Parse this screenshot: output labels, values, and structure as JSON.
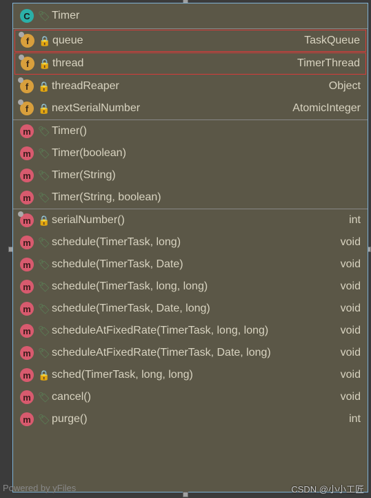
{
  "header": {
    "class_name": "Timer"
  },
  "fields": [
    {
      "name": "queue",
      "type": "TaskQueue",
      "access": "private",
      "pinned": true,
      "highlight": true
    },
    {
      "name": "thread",
      "type": "TimerThread",
      "access": "private",
      "pinned": true,
      "highlight": true
    },
    {
      "name": "threadReaper",
      "type": "Object",
      "access": "private",
      "pinned": true,
      "highlight": false
    },
    {
      "name": "nextSerialNumber",
      "type": "AtomicInteger",
      "access": "private",
      "pinned": true,
      "highlight": false
    }
  ],
  "constructors": [
    {
      "signature": "Timer()"
    },
    {
      "signature": "Timer(boolean)"
    },
    {
      "signature": "Timer(String)"
    },
    {
      "signature": "Timer(String, boolean)"
    }
  ],
  "methods": [
    {
      "signature": "serialNumber()",
      "return": "int",
      "access": "private",
      "pinned": true
    },
    {
      "signature": "schedule(TimerTask, long)",
      "return": "void",
      "access": "public",
      "pinned": false
    },
    {
      "signature": "schedule(TimerTask, Date)",
      "return": "void",
      "access": "public",
      "pinned": false
    },
    {
      "signature": "schedule(TimerTask, long, long)",
      "return": "void",
      "access": "public",
      "pinned": false
    },
    {
      "signature": "schedule(TimerTask, Date, long)",
      "return": "void",
      "access": "public",
      "pinned": false
    },
    {
      "signature": "scheduleAtFixedRate(TimerTask, long, long)",
      "return": "void",
      "access": "public",
      "pinned": false
    },
    {
      "signature": "scheduleAtFixedRate(TimerTask, Date, long)",
      "return": "void",
      "access": "public",
      "pinned": false
    },
    {
      "signature": "sched(TimerTask, long, long)",
      "return": "void",
      "access": "private",
      "pinned": false
    },
    {
      "signature": "cancel()",
      "return": "void",
      "access": "public",
      "pinned": false
    },
    {
      "signature": "purge()",
      "return": "int",
      "access": "public",
      "pinned": false
    }
  ],
  "footer": {
    "powered_by": "Powered by yFiles",
    "watermark": "CSDN @小小工匠"
  }
}
